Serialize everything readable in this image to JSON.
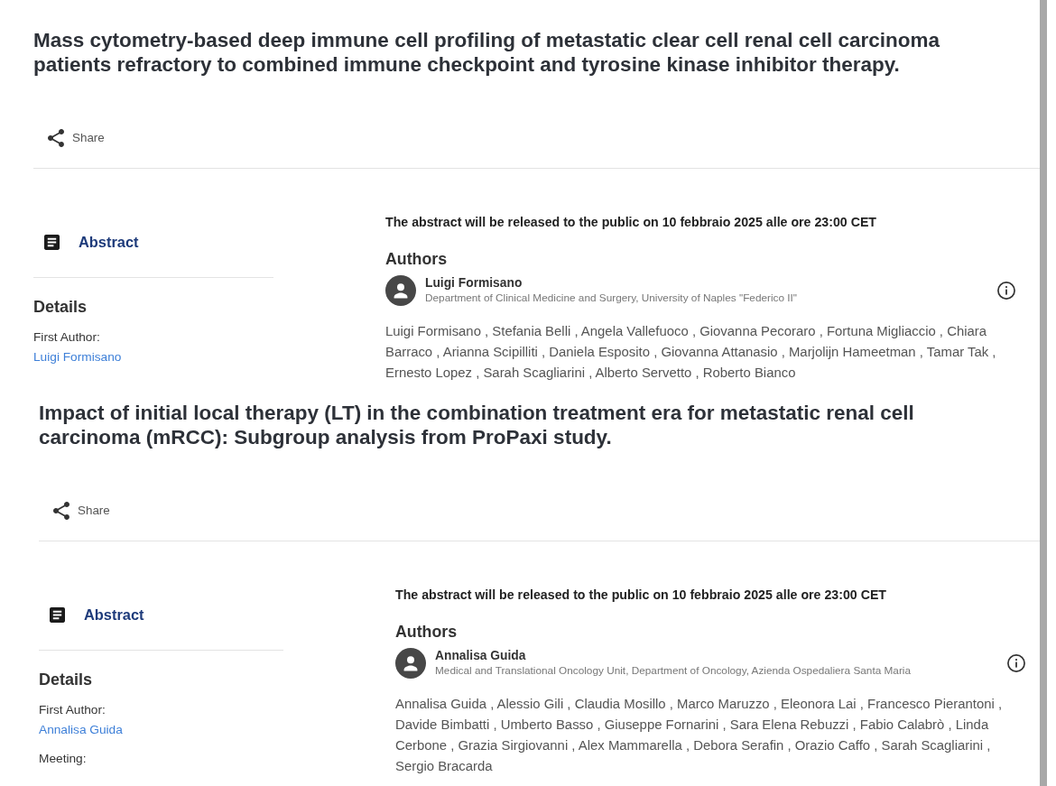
{
  "articles": [
    {
      "title": "Mass cytometry-based deep immune cell profiling of metastatic clear cell renal cell carcinoma patients refractory to combined immune checkpoint and tyrosine kinase inhibitor therapy.",
      "share": "Share",
      "nav": [
        {
          "label": "Abstract"
        }
      ],
      "details": {
        "heading": "Details",
        "fields": [
          {
            "label": "First Author:",
            "value": "Luigi Formisano"
          }
        ]
      },
      "notice": "The abstract will be released to the public on 10 febbraio 2025 alle ore 23:00 CET",
      "authors": {
        "heading": "Authors",
        "lead": {
          "name": "Luigi Formisano",
          "affiliation": "Department of Clinical Medicine and Surgery, University of Naples \"Federico II\""
        },
        "list": "Luigi Formisano , Stefania Belli , Angela Vallefuoco , Giovanna Pecoraro , Fortuna Migliaccio , Chiara Barraco , Arianna Scipilliti , Daniela Esposito , Giovanna Attanasio , Marjolijn Hameetman , Tamar Tak , Ernesto Lopez , Sarah Scagliarini , Alberto Servetto , Roberto Bianco"
      }
    },
    {
      "title": "Impact of initial local therapy (LT) in the combination treatment era for metastatic renal cell carcinoma (mRCC): Subgroup analysis from ProPaxi study.",
      "share": "Share",
      "nav": [
        {
          "label": "Abstract"
        }
      ],
      "details": {
        "heading": "Details",
        "fields": [
          {
            "label": "First Author:",
            "value": "Annalisa Guida"
          },
          {
            "label": "Meeting:"
          }
        ]
      },
      "notice": "The abstract will be released to the public on 10 febbraio 2025 alle ore 23:00 CET",
      "authors": {
        "heading": "Authors",
        "lead": {
          "name": "Annalisa Guida",
          "affiliation": "Medical and Translational Oncology Unit, Department of Oncology, Azienda Ospedaliera Santa Maria"
        },
        "list": "Annalisa Guida , Alessio Gili , Claudia Mosillo , Marco Maruzzo , Eleonora Lai , Francesco Pierantoni , Davide Bimbatti , Umberto Basso , Giuseppe Fornarini , Sara Elena Rebuzzi , Fabio Calabrò , Linda Cerbone , Grazia Sirgiovanni , Alex Mammarella , Debora Serafin , Orazio Caffo , Sarah Scagliarini , Sergio Bracarda"
      }
    }
  ]
}
